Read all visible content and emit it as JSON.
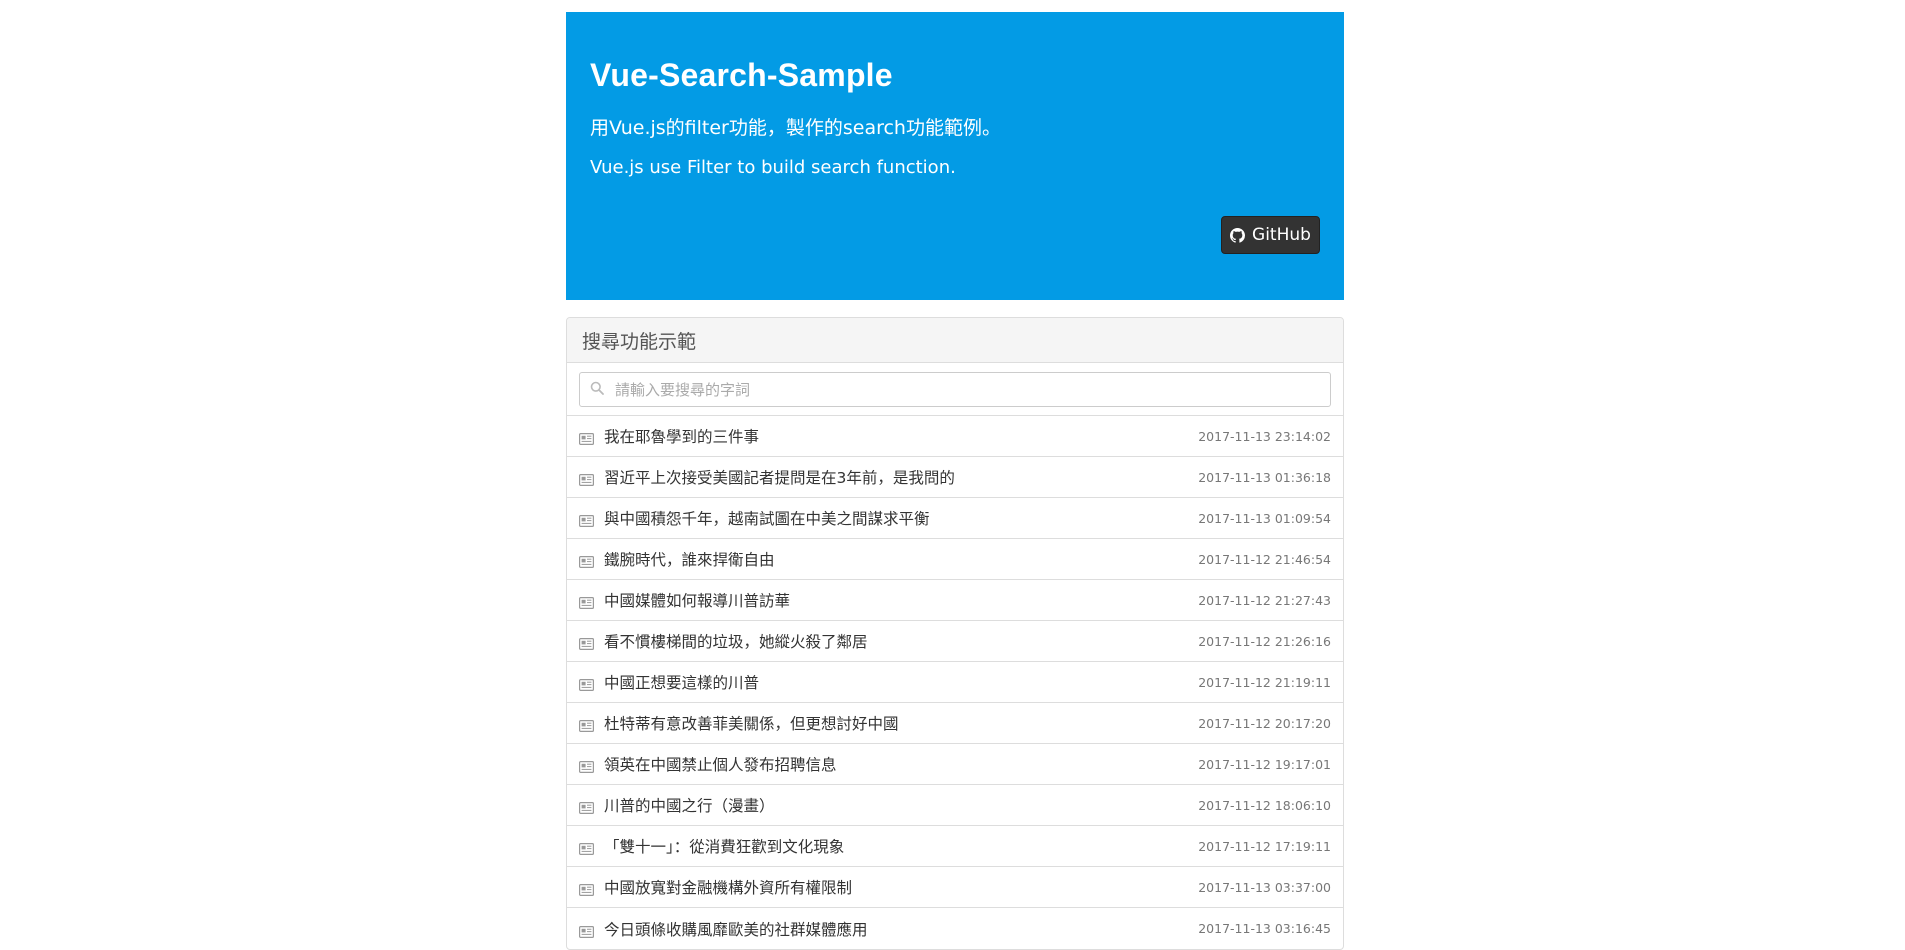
{
  "header": {
    "title": "Vue-Search-Sample",
    "subtitle_zh": "用Vue.js的filter功能，製作的search功能範例。",
    "subtitle_en": "Vue.js use Filter to build search function.",
    "github_label": "GitHub",
    "github_icon": "github-icon",
    "background_color": "#039be5"
  },
  "panel": {
    "heading": "搜尋功能示範",
    "search": {
      "placeholder": "請輸入要搜尋的字詞",
      "value": "",
      "icon": "search-icon"
    },
    "item_icon": "newspaper-icon",
    "items": [
      {
        "title": "我在耶魯學到的三件事",
        "time": "2017-11-13 23:14:02"
      },
      {
        "title": "習近平上次接受美國記者提問是在3年前，是我問的",
        "time": "2017-11-13 01:36:18"
      },
      {
        "title": "與中國積怨千年，越南試圖在中美之間謀求平衡",
        "time": "2017-11-13 01:09:54"
      },
      {
        "title": "鐵腕時代，誰來捍衛自由",
        "time": "2017-11-12 21:46:54"
      },
      {
        "title": "中國媒體如何報導川普訪華",
        "time": "2017-11-12 21:27:43"
      },
      {
        "title": "看不慣樓梯間的垃圾，她縱火殺了鄰居",
        "time": "2017-11-12 21:26:16"
      },
      {
        "title": "中國正想要這樣的川普",
        "time": "2017-11-12 21:19:11"
      },
      {
        "title": "杜特蒂有意改善菲美關係，但更想討好中國",
        "time": "2017-11-12 20:17:20"
      },
      {
        "title": "領英在中國禁止個人發布招聘信息",
        "time": "2017-11-12 19:17:01"
      },
      {
        "title": "川普的中國之行（漫畫）",
        "time": "2017-11-12 18:06:10"
      },
      {
        "title": "「雙十一」：從消費狂歡到文化現象",
        "time": "2017-11-12 17:19:11"
      },
      {
        "title": "中國放寬對金融機構外資所有權限制",
        "time": "2017-11-13 03:37:00"
      },
      {
        "title": "今日頭條收購風靡歐美的社群媒體應用",
        "time": "2017-11-13 03:16:45"
      }
    ]
  }
}
